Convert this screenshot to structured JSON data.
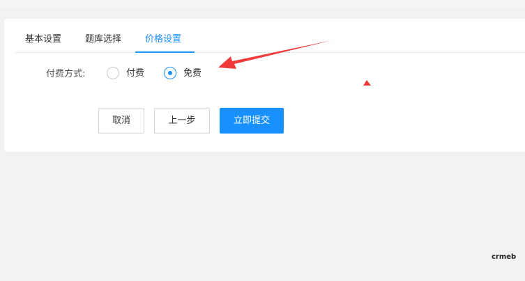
{
  "tabs": [
    {
      "label": "基本设置",
      "active": false
    },
    {
      "label": "题库选择",
      "active": false
    },
    {
      "label": "价格设置",
      "active": true
    }
  ],
  "form": {
    "payment_label": "付费方式:",
    "options": [
      {
        "label": "付费",
        "checked": false
      },
      {
        "label": "免费",
        "checked": true
      }
    ]
  },
  "buttons": {
    "cancel": "取消",
    "prev": "上一步",
    "submit": "立即提交"
  },
  "colors": {
    "accent": "#1890ff",
    "annotation_arrow": "#f03a3a",
    "page_bg": "#f2f2f2"
  },
  "watermark": "crmeb"
}
